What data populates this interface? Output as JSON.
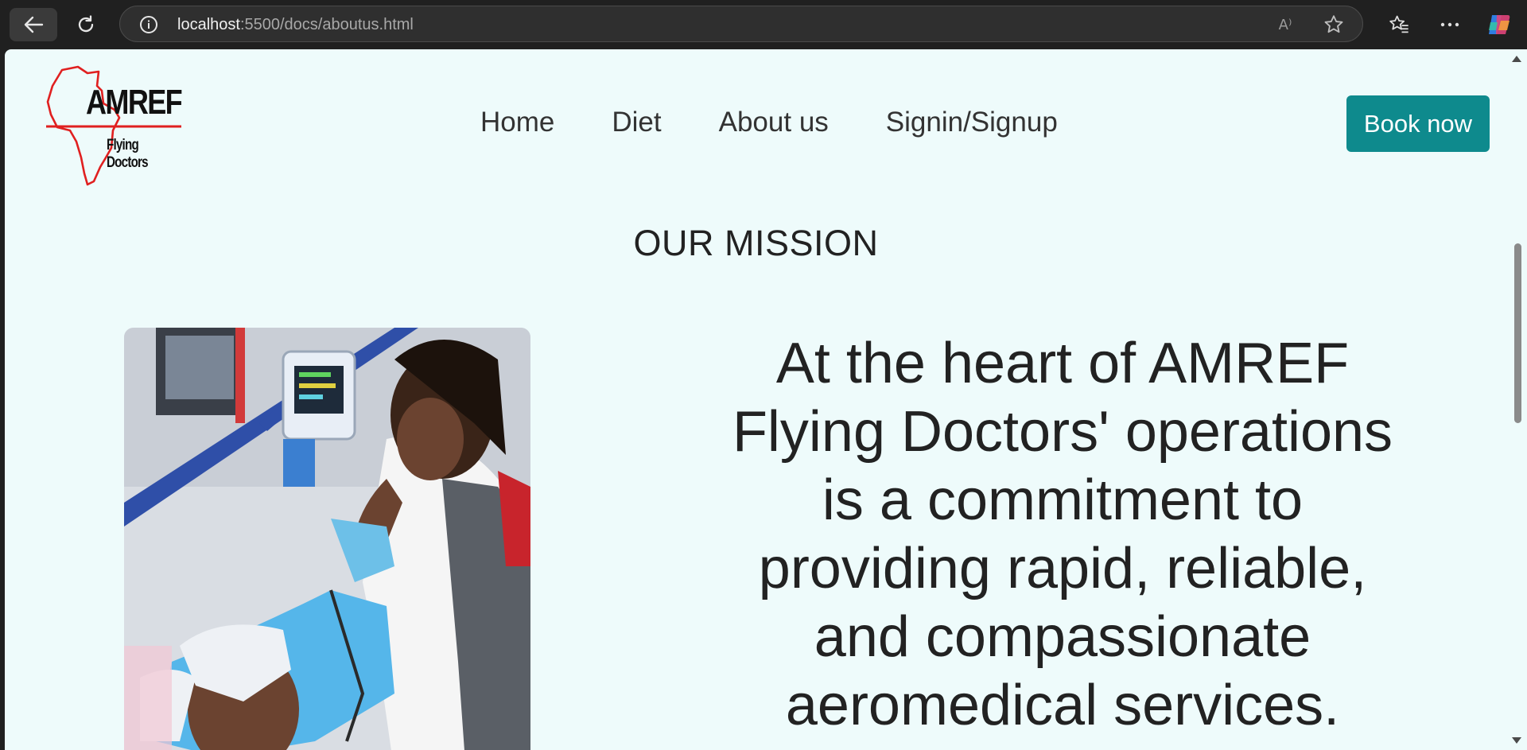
{
  "browser": {
    "url_host": "localhost",
    "url_rest": ":5500/docs/aboutus.html",
    "read_aloud_glyph": "A⁾"
  },
  "site": {
    "logo": {
      "brand": "AMREF",
      "tagline": "Flying Doctors"
    },
    "nav": [
      "Home",
      "Diet",
      "About us",
      "Signin/Signup"
    ],
    "book_button": "Book now"
  },
  "mission": {
    "title": "OUR MISSION",
    "statement": "At the heart of AMREF Flying Doctors' operations is a commitment to providing rapid, reliable, and compassionate aeromedical services."
  },
  "colors": {
    "page_bg": "#eefbfb",
    "accent": "#0e8a8d",
    "logo_red": "#e02020"
  },
  "icons": [
    "back-arrow-icon",
    "reload-icon",
    "info-icon",
    "read-aloud-icon",
    "star-icon",
    "favorites-icon",
    "more-icon",
    "copilot-icon"
  ]
}
